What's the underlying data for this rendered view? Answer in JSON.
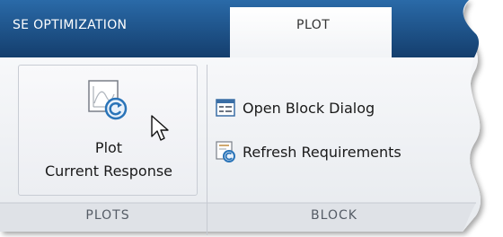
{
  "tabs": {
    "inactive_label": "SE OPTIMIZATION",
    "active_label": "PLOT"
  },
  "plots_group": {
    "label": "PLOTS",
    "plot_button": {
      "line1": "Plot",
      "line2": "Current Response",
      "icon": "plot-response-icon"
    }
  },
  "block_group": {
    "label": "BLOCK",
    "items": [
      {
        "label": "Open Block Dialog",
        "icon": "block-dialog-icon"
      },
      {
        "label": "Refresh Requirements",
        "icon": "refresh-requirements-icon"
      }
    ]
  },
  "colors": {
    "tab_strip": "#1b4f86",
    "ribbon": "#eef0f3",
    "group_label_bar": "#dfe2e7",
    "accent": "#2a74b8"
  }
}
